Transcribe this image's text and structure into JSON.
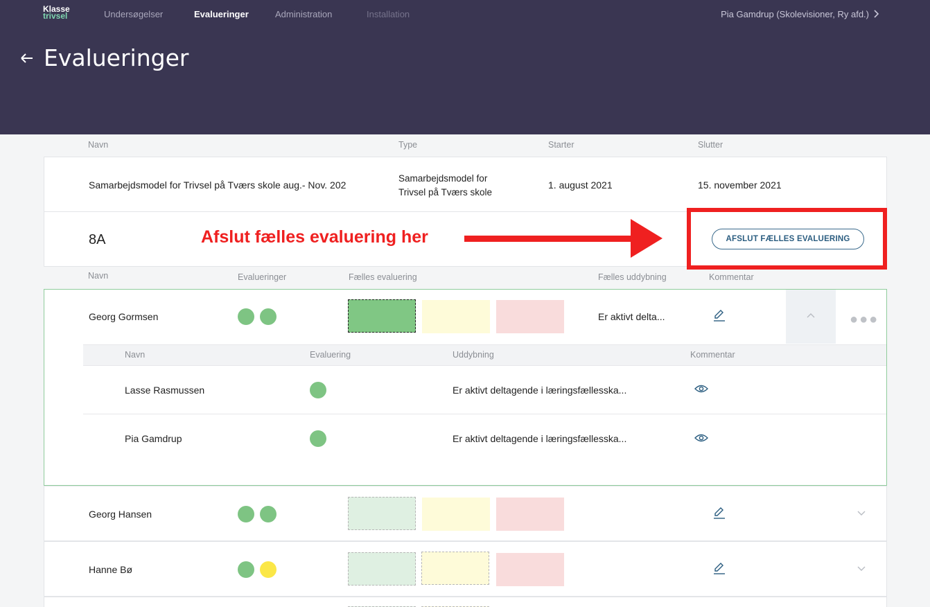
{
  "app": {
    "logo_line1": "Klasse",
    "logo_line2": "trivsel",
    "nav": [
      {
        "label": "Undersøgelser",
        "state": "normal"
      },
      {
        "label": "Evalueringer",
        "state": "active"
      },
      {
        "label": "Administration",
        "state": "normal"
      },
      {
        "label": "Installation",
        "state": "dim"
      }
    ],
    "user": "Pia Gamdrup (Skolevisioner, Ry afd.)",
    "page_title": "Evalueringer"
  },
  "evaluation_table": {
    "headers": {
      "name": "Navn",
      "type": "Type",
      "starts": "Starter",
      "ends": "Slutter"
    },
    "row": {
      "name": "Samarbejdsmodel for Trivsel på Tværs skole aug.- Nov. 202",
      "type_line1": "Samarbejdsmodel for",
      "type_line2": "Trivsel på Tværs skole",
      "starts": "1. august 2021",
      "ends": "15. november 2021"
    }
  },
  "class_section": {
    "class_name": "8A",
    "annotation": "Afslut fælles evaluering her",
    "finish_button": "AFSLUT FÆLLES EVALUERING"
  },
  "students_table": {
    "headers": {
      "name": "Navn",
      "evaluations": "Evalueringer",
      "joint_evaluation": "Fælles evaluering",
      "joint_elaboration": "Fælles uddybning",
      "comment": "Kommentar"
    },
    "sub_headers": {
      "name": "Navn",
      "evaluation": "Evaluering",
      "elaboration": "Uddybning",
      "comment": "Kommentar"
    },
    "students": [
      {
        "name": "Georg Gormsen",
        "evaluations": [
          "green",
          "green"
        ],
        "joint_selected": "green",
        "joint_elaboration": "Er aktivt delta...",
        "expanded": true,
        "evaluators": [
          {
            "name": "Lasse Rasmussen",
            "evaluation": "green",
            "elaboration": "Er aktivt deltagende i læringsfællesska..."
          },
          {
            "name": "Pia Gamdrup",
            "evaluation": "green",
            "elaboration": "Er aktivt deltagende i læringsfællesska..."
          }
        ]
      },
      {
        "name": "Georg Hansen",
        "evaluations": [
          "green",
          "green"
        ],
        "expanded": false
      },
      {
        "name": "Hanne Bø",
        "evaluations": [
          "green",
          "yellow"
        ],
        "expanded": false
      }
    ]
  },
  "colors": {
    "header_bg": "#3a3652",
    "green": "#7ec483",
    "yellow": "#fbe747",
    "red_box": "#f9dcdc",
    "annotation_red": "#ef2020",
    "accent_blue": "#2b5d80"
  }
}
